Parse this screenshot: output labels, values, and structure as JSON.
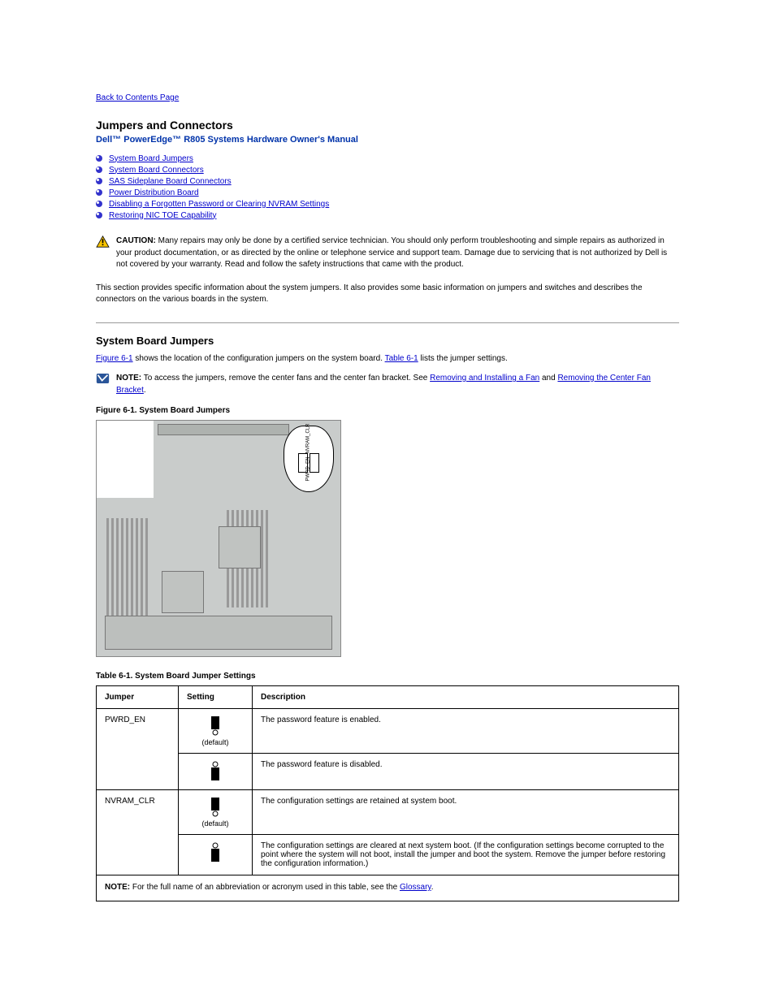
{
  "nav": {
    "back": "Back to Contents Page"
  },
  "header": {
    "title": "Jumpers and Connectors",
    "subtitle": "Dell™ PowerEdge™ R805 Systems Hardware Owner's Manual"
  },
  "toc": [
    {
      "label": "System Board Jumpers"
    },
    {
      "label": "System Board Connectors"
    },
    {
      "label": "SAS Sideplane Board Connectors"
    },
    {
      "label": "Power Distribution Board"
    },
    {
      "label": "Disabling a Forgotten Password or Clearing NVRAM Settings"
    },
    {
      "label": "Restoring NIC TOE Capability"
    }
  ],
  "intro": "This section provides specific information about the system jumpers. It also provides some basic information on jumpers and switches and describes the connectors on the various boards in the system.",
  "caution": {
    "label": "CAUTION:",
    "text": " Many repairs may only be done by a certified service technician. You should only perform troubleshooting and simple repairs as authorized in your product documentation, or as directed by the online or telephone service and support team. Damage due to servicing that is not authorized by Dell is not covered by your warranty. Read and follow the safety instructions that came with the product."
  },
  "section1": {
    "heading": "System Board Jumpers",
    "para_before_fig": " shows the location of the configuration jumpers on the system board. ",
    "para_after_fig": " lists the jumper settings.",
    "fig_link": "Figure 6-1",
    "tbl_link": "Table 6-1"
  },
  "note": {
    "label": "NOTE:",
    "text_before": " To access the jumpers, remove the center fans and the center fan bracket. See ",
    "link1": "Removing and Installing a Fan",
    "text_mid": " and ",
    "link2": "Removing the Center Fan Bracket",
    "text_after": "."
  },
  "figure": {
    "caption": "Figure 6-1. System Board Jumpers",
    "callout_labels": [
      "PWRD_EN",
      "NVRAM_CLR"
    ]
  },
  "table": {
    "caption": "Table 6-1. System Board Jumper Settings",
    "headers": [
      "Jumper",
      "Setting",
      "Description"
    ],
    "rows": [
      {
        "jumper": "PWRD_EN",
        "svg": "top",
        "default": true,
        "desc": "The password feature is enabled."
      },
      {
        "jumper": "",
        "svg": "bottom",
        "default": false,
        "desc": "The password feature is disabled."
      },
      {
        "jumper": "NVRAM_CLR",
        "svg": "top",
        "default": true,
        "desc": "The configuration settings are retained at system boot."
      },
      {
        "jumper": "",
        "svg": "bottom",
        "default": false,
        "desc": "The configuration settings are cleared at next system boot. (If the configuration settings become corrupted to the point where the system will not boot, install the jumper and boot the system. Remove the jumper before restoring the configuration information.)"
      }
    ],
    "default_label": "(default)",
    "footnote_label": "NOTE:",
    "footnote_before": " For the full name of an abbreviation or acronym used in this table, see the ",
    "footnote_link": "Glossary",
    "footnote_after": "."
  }
}
